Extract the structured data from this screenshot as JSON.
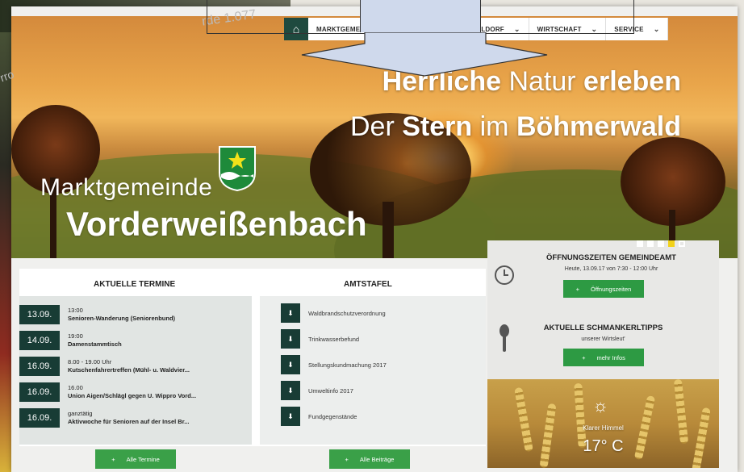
{
  "nav": {
    "items": [
      {
        "label": "MARKTGEMEIN",
        "dropdown": false
      },
      {
        "label": "SCHMANKERLDORF",
        "dropdown": true
      },
      {
        "label": "WIRTSCHAFT",
        "dropdown": true
      },
      {
        "label": "SERVICE",
        "dropdown": true
      }
    ]
  },
  "hero": {
    "slogan1_a": "Herrliche",
    "slogan1_b": "Natur",
    "slogan1_c": "erleben",
    "slogan2_a": "Der",
    "slogan2_b": "Stern",
    "slogan2_c": "im",
    "slogan2_d": "Böhmerwald",
    "title_small": "Marktgemeinde",
    "title_big": "Vorderweißenbach",
    "bg_text": "rde 1.077",
    "bg_text2": "rro"
  },
  "termine": {
    "heading": "AKTUELLE TERMINE",
    "items": [
      {
        "date": "13.09.",
        "time": "13:00",
        "name": "Senioren-Wanderung (Seniorenbund)"
      },
      {
        "date": "14.09.",
        "time": "19:00",
        "name": "Damenstammtisch"
      },
      {
        "date": "16.09.",
        "time": "8.00 - 19.00 Uhr",
        "name": "Kutschenfahrertreffen (Mühl- u. Waldvier..."
      },
      {
        "date": "16.09.",
        "time": "16.00",
        "name": "Union Aigen/Schlägl gegen U. Wippro Vord..."
      },
      {
        "date": "16.09.",
        "time": "ganztätig",
        "name": "Aktivwoche für Senioren auf der Insel Br..."
      }
    ],
    "button": "Alle Termine"
  },
  "amtstafel": {
    "heading": "AMTSTAFEL",
    "items": [
      "Waldbrandschutzverordnung",
      "Trinkwasserbefund",
      "Stellungskundmachung 2017",
      "Umweltinfo 2017",
      "Fundgegenstände"
    ],
    "button": "Alle Beiträge"
  },
  "sidebar": {
    "oeffnung_heading": "ÖFFNUNGSZEITEN GEMEINDEAMT",
    "oeffnung_sub": "Heute, 13.09.17 von 7:30 - 12:00 Uhr",
    "oeffnung_button": "Öffnungszeiten",
    "tipps_heading": "AKTUELLE SCHMANKERLTIPPS",
    "tipps_sub": "unserer Wirtsleut'",
    "tipps_button": "mehr Infos",
    "weather_label": "Klarer Himmel",
    "weather_temp": "17° C"
  },
  "slider": {
    "count": 5,
    "active_index": 3
  },
  "colors": {
    "dark_green": "#183c35",
    "button_green": "#3aa048",
    "accent_yellow": "#f2d21a"
  }
}
